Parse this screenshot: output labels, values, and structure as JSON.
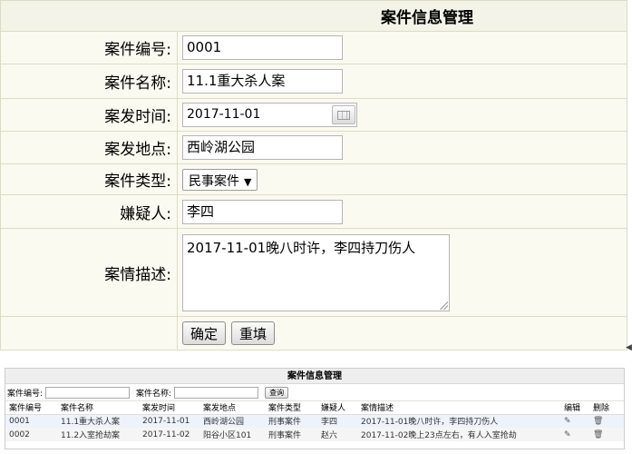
{
  "form": {
    "title": "案件信息管理",
    "labels": {
      "case_no": "案件编号:",
      "case_name": "案件名称:",
      "date": "案发时间:",
      "location": "案发地点:",
      "type": "案件类型:",
      "suspect": "嫌疑人:",
      "description": "案情描述:"
    },
    "values": {
      "case_no": "0001",
      "case_name": "11.1重大杀人案",
      "date": "2017-11-01",
      "location": "西岭湖公园",
      "type": "民事案件",
      "suspect": "李四",
      "description": "2017-11-01晚八时许，李四持刀伤人"
    },
    "buttons": {
      "confirm": "确定",
      "reset": "重填"
    }
  },
  "list": {
    "title": "案件信息管理",
    "search": {
      "case_no_label": "案件编号:",
      "case_name_label": "案件名称:",
      "query_button": "查询"
    },
    "columns": [
      "案件编号",
      "案件名称",
      "案发时间",
      "案发地点",
      "案件类型",
      "嫌疑人",
      "案情描述",
      "编辑",
      "删除"
    ],
    "rows": [
      {
        "no": "0001",
        "name": "11.1重大杀人案",
        "date": "2017-11-01",
        "location": "西岭湖公园",
        "type": "刑事案件",
        "suspect": "李四",
        "desc": "2017-11-01晚八时许，李四持刀伤人"
      },
      {
        "no": "0002",
        "name": "11.2入室抢劫案",
        "date": "2017-11-02",
        "location": "阳谷小区101",
        "type": "刑事案件",
        "suspect": "赵六",
        "desc": "2017-11-02晚上23点左右，有人入室抢劫"
      }
    ],
    "icons": {
      "edit": "edit-icon",
      "delete": "trash-icon"
    }
  }
}
